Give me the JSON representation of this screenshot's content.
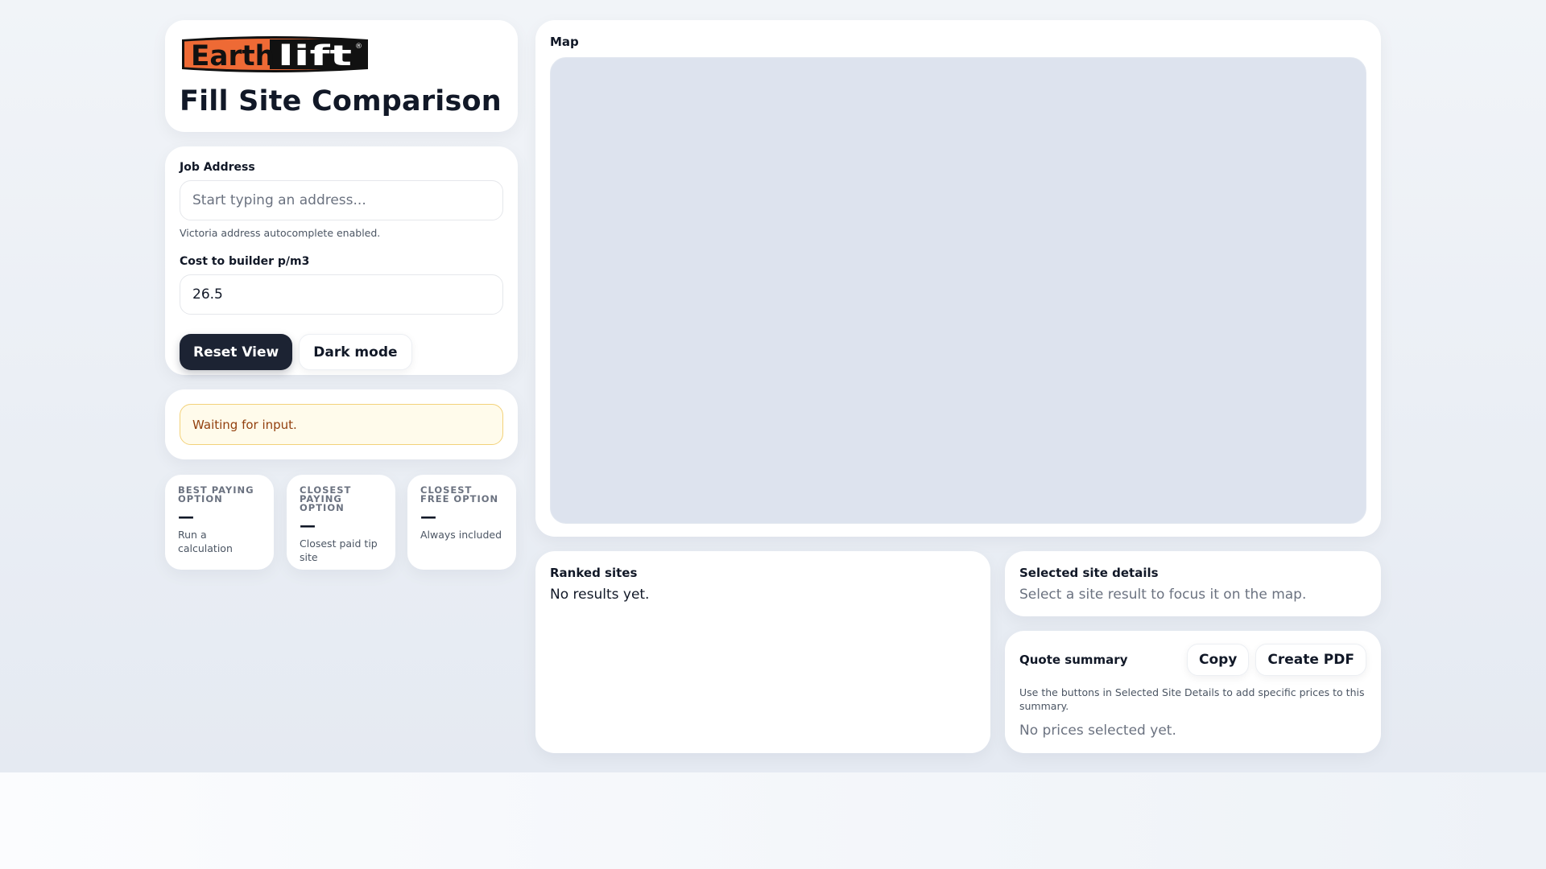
{
  "brand": {
    "logo_text_part1": "Earth",
    "logo_text_part2": "lift",
    "logo_registered": "®",
    "logo_colors": {
      "orange": "#ee6a35",
      "black": "#111111"
    }
  },
  "header": {
    "title": "Fill Site Comparison"
  },
  "inputs": {
    "address_label": "Job Address",
    "address_placeholder": "Start typing an address...",
    "address_hint": "Victoria address autocomplete enabled.",
    "cost_label": "Cost to builder p/m3",
    "cost_value": "26.5",
    "reset_button": "Reset View",
    "dark_mode_button": "Dark mode"
  },
  "status": {
    "message": "Waiting for input."
  },
  "stats": [
    {
      "label": "Best paying option",
      "value": "—",
      "sub": "Run a calculation"
    },
    {
      "label": "Closest paying option",
      "value": "—",
      "sub": "Closest paid tip site"
    },
    {
      "label": "Closest free option",
      "value": "—",
      "sub": "Always included"
    }
  ],
  "map": {
    "title": "Map"
  },
  "ranked": {
    "title": "Ranked sites",
    "empty": "No results yet."
  },
  "selected": {
    "title": "Selected site details",
    "empty": "Select a site result to focus it on the map."
  },
  "quote": {
    "title": "Quote summary",
    "copy_button": "Copy",
    "pdf_button": "Create PDF",
    "hint": "Use the buttons in Selected Site Details to add specific prices to this summary.",
    "empty": "No prices selected yet."
  }
}
